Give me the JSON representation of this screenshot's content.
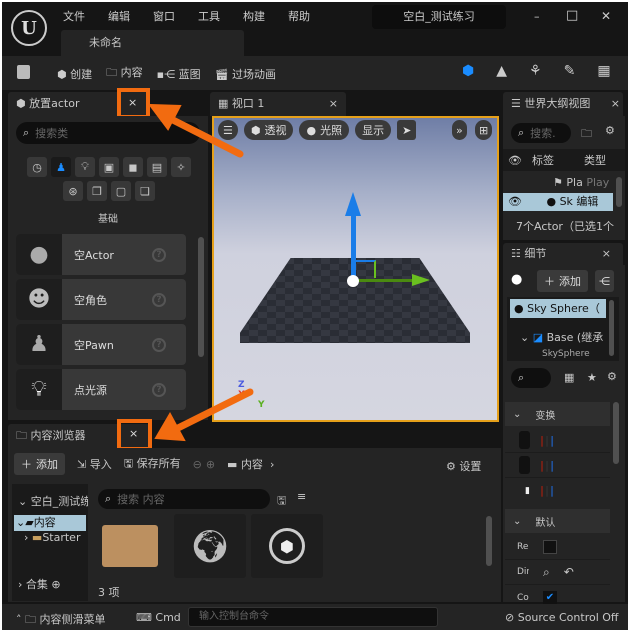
{
  "titlebar": {
    "menu": [
      "文件",
      "编辑",
      "窗口",
      "工具",
      "构建",
      "帮助"
    ],
    "project": "空白_测试练习",
    "level_tab": "未命名",
    "minimize": "–",
    "maximize": "□",
    "close": "✕"
  },
  "toolbar": {
    "create": "创建",
    "content": "内容",
    "blueprint": "蓝图",
    "cinematics": "过场动画"
  },
  "place_actor": {
    "tab": "放置actor",
    "close": "×",
    "search_placeholder": "搜索类",
    "category": "基础",
    "items": [
      {
        "label": "空Actor",
        "icon": "sphere-icon"
      },
      {
        "label": "空角色",
        "icon": "character-icon"
      },
      {
        "label": "空Pawn",
        "icon": "pawn-icon"
      },
      {
        "label": "点光源",
        "icon": "light-bulb-icon"
      }
    ]
  },
  "viewport": {
    "tab": "视口 1",
    "close": "×",
    "perspective": "透视",
    "lighting": "光照",
    "show": "显示",
    "axis": {
      "z": "Z",
      "x": "X",
      "y": "Y"
    }
  },
  "outliner": {
    "tab": "世界大纲视图",
    "close": "×",
    "search_placeholder": "搜索.",
    "col_label": "标签",
    "col_type": "类型",
    "rows": [
      {
        "label": "Pla",
        "type": "Play"
      },
      {
        "label": "Sk",
        "type": "编辑"
      }
    ],
    "status": "7个Actor（已选1个"
  },
  "details": {
    "tab": "细节",
    "close": "×",
    "add": "添加",
    "selected": "Sky Sphere（",
    "component": "Base (继承",
    "sub": "SkySphere",
    "section_transform": "变换",
    "section_default": "默认",
    "props": [
      "Re",
      "Dir",
      "Co"
    ],
    "checkbox_checked": true
  },
  "content_browser": {
    "tab": "内容浏览器",
    "close": "×",
    "add": "添加",
    "import": "导入",
    "save_all": "保存所有",
    "path": "内容",
    "settings": "设置",
    "tree": {
      "root": "空白_测试练",
      "content": "内容",
      "starter": "Starter",
      "collections": "合集"
    },
    "search_placeholder": "搜索 内容",
    "count": "3 项"
  },
  "statusbar": {
    "drawer": "内容侧滑菜单",
    "cmd": "Cmd",
    "console_placeholder": "输入控制台命令",
    "source_control": "Source Control Off"
  },
  "colors": {
    "accent": "#f26b10",
    "viewport_border": "#e5a01a",
    "selection": "#a9c8d8",
    "blue": "#1a8cff"
  }
}
